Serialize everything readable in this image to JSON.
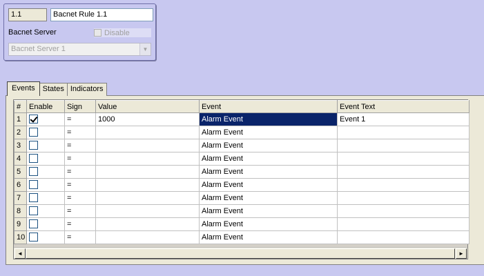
{
  "rule": {
    "id": "1.1",
    "name": "Bacnet Rule 1.1",
    "server_label": "Bacnet Server",
    "disable_label": "Disable",
    "disable_checked": false,
    "server_value": "Bacnet Server 1"
  },
  "tabs": [
    {
      "label": "Events",
      "active": true
    },
    {
      "label": "States",
      "active": false
    },
    {
      "label": "Indicators",
      "active": false
    }
  ],
  "grid": {
    "columns": [
      "#",
      "Enable",
      "Sign",
      "Value",
      "Event",
      "Event Text"
    ],
    "rows": [
      {
        "num": "1",
        "enabled": true,
        "sign": "=",
        "value": "1000",
        "event": "Alarm Event",
        "text": "Event 1"
      },
      {
        "num": "2",
        "enabled": false,
        "sign": "=",
        "value": "",
        "event": "Alarm Event",
        "text": ""
      },
      {
        "num": "3",
        "enabled": false,
        "sign": "=",
        "value": "",
        "event": "Alarm Event",
        "text": ""
      },
      {
        "num": "4",
        "enabled": false,
        "sign": "=",
        "value": "",
        "event": "Alarm Event",
        "text": ""
      },
      {
        "num": "5",
        "enabled": false,
        "sign": "=",
        "value": "",
        "event": "Alarm Event",
        "text": ""
      },
      {
        "num": "6",
        "enabled": false,
        "sign": "=",
        "value": "",
        "event": "Alarm Event",
        "text": ""
      },
      {
        "num": "7",
        "enabled": false,
        "sign": "=",
        "value": "",
        "event": "Alarm Event",
        "text": ""
      },
      {
        "num": "8",
        "enabled": false,
        "sign": "=",
        "value": "",
        "event": "Alarm Event",
        "text": ""
      },
      {
        "num": "9",
        "enabled": false,
        "sign": "=",
        "value": "",
        "event": "Alarm Event",
        "text": ""
      },
      {
        "num": "10",
        "enabled": false,
        "sign": "=",
        "value": "",
        "event": "Alarm Event",
        "text": ""
      }
    ],
    "selected_row": 0,
    "selected_column": "event"
  },
  "scrollbar": {
    "left_arrow": "◄",
    "right_arrow": "►"
  }
}
